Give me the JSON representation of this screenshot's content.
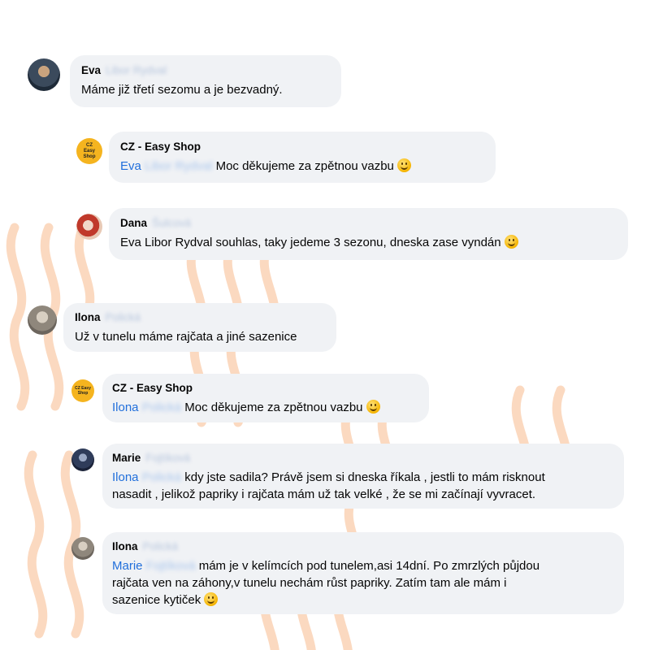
{
  "comments": [
    {
      "name": "Eva",
      "surname": "Libor Rydval",
      "text": "Máme již třetí sezomu a je bezvadný."
    },
    {
      "name": "CZ - Easy Shop",
      "mention_first": "Eva",
      "mention_rest": "Libor Rydval",
      "text": "Moc děkujeme za zpětnou vazbu"
    },
    {
      "name": "Dana",
      "surname": "Šulcová",
      "text": "Eva Libor Rydval souhlas, taky jedeme 3 sezonu, dneska zase vyndán"
    },
    {
      "name": "Ilona",
      "surname": "Polická",
      "text": "Už v tunelu máme rajčata a jiné sazenice"
    },
    {
      "name": "CZ - Easy Shop",
      "mention_first": "Ilona",
      "mention_rest": "Polická",
      "text": "Moc děkujeme za zpětnou vazbu"
    },
    {
      "name": "Marie",
      "surname": "Fojtíková",
      "mention_first": "Ilona",
      "mention_rest": "Polická",
      "text_line1": "kdy jste sadila? Právě jsem si dneska říkala , jestli to mám risknout",
      "text_line2": "nasadit , jelikož papriky i rajčata mám už tak velké , že se mi začínají vyvracet."
    },
    {
      "name": "Ilona",
      "surname": "Polická",
      "mention_first": "Marie",
      "mention_rest": "Fojtíková",
      "text_line1": "mám je v kelímcích pod tunelem,asi 14dní. Po zmrzlých půjdou",
      "text_line2": "rajčata ven na záhony,v tunelu nechám růst papriky. Zatím tam ale mám i",
      "text_line3": "sazenice kytiček"
    }
  ],
  "shop_logo_text": "CZ Easy Shop",
  "colors": {
    "bubble": "#f0f2f5",
    "mention": "#216fdb",
    "wave": "#fbd9c0",
    "logo": "#f5b41f"
  }
}
